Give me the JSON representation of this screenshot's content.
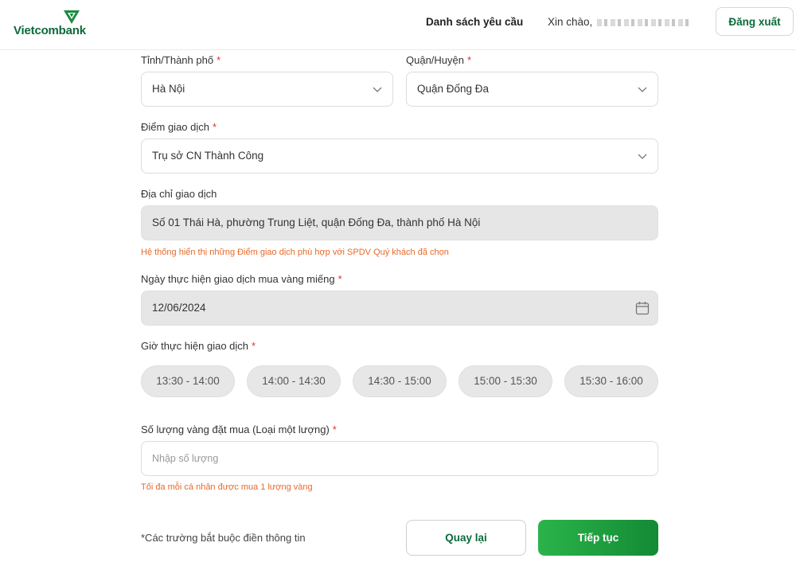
{
  "header": {
    "brand": "Vietcombank",
    "nav_link": "Danh sách yêu cầu",
    "greeting": "Xin chào,",
    "logout": "Đăng xuất"
  },
  "form": {
    "province": {
      "label": "Tỉnh/Thành phố",
      "required_mark": "*",
      "value": "Hà Nội"
    },
    "district": {
      "label": "Quận/Huyện",
      "required_mark": "*",
      "value": "Quận Đống Đa"
    },
    "branch": {
      "label": "Điểm giao dịch",
      "required_mark": "*",
      "value": "Trụ sở CN Thành Công"
    },
    "address": {
      "label": "Địa chỉ giao dịch",
      "value": "Số 01 Thái Hà, phường Trung Liệt, quận Đống Đa, thành phố Hà Nội",
      "hint": "Hệ thống hiển thị những Điểm giao dịch phù hợp với SPDV Quý khách đã chọn"
    },
    "date": {
      "label": "Ngày thực hiện giao dịch mua vàng miếng",
      "required_mark": "*",
      "value": "12/06/2024"
    },
    "time": {
      "label": "Giờ thực hiện giao dịch",
      "required_mark": "*",
      "slots": [
        "13:30 - 14:00",
        "14:00 - 14:30",
        "14:30 - 15:00",
        "15:00 - 15:30",
        "15:30 - 16:00"
      ]
    },
    "quantity": {
      "label": "Số lượng vàng đặt mua (Loại một lượng)",
      "required_mark": "*",
      "placeholder": "Nhập số lượng",
      "hint": "Tối đa mỗi cá nhân được mua 1 lượng vàng"
    }
  },
  "footer": {
    "required_note": "*Các trường bắt buộc điền thông tin",
    "back": "Quay lại",
    "next": "Tiếp tục"
  },
  "colors": {
    "brand_green": "#0a6b3a",
    "required_red": "#e5302b",
    "hint_orange": "#e86a2a"
  },
  "icons": [
    "vietcombank-logo-icon",
    "chevron-down-icon",
    "calendar-icon"
  ]
}
